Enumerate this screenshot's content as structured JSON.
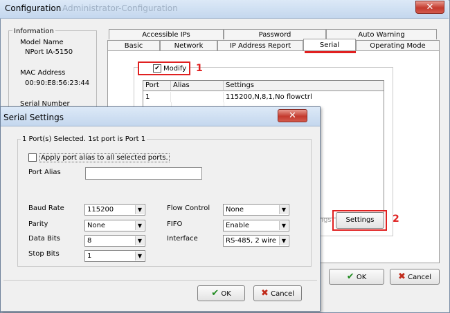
{
  "window": {
    "title": "Configuration",
    "ghost_title": "Administrator-Configuration",
    "close_glyph": "✕"
  },
  "info": {
    "legend": "Information",
    "model_name_label": "Model Name",
    "model_name_value": "NPort IA-5150",
    "mac_label": "MAC Address",
    "mac_value": "00:90:E8:56:23:44",
    "serial_number_label": "Serial Number"
  },
  "tabs": {
    "row1": [
      "Accessible IPs",
      "Password",
      "Auto Warning"
    ],
    "row2": [
      "Basic",
      "Network",
      "IP Address Report",
      "Serial",
      "Operating Mode"
    ],
    "active": "Serial"
  },
  "serial_panel": {
    "modify_checked": true,
    "modify_label": "Modify",
    "annotation_1": "1",
    "annotation_2": "2",
    "table_headers": [
      "Port",
      "Alias",
      "Settings"
    ],
    "rows": [
      {
        "port": "1",
        "alias": "",
        "settings": "115200,N,8,1,No flowctrl"
      }
    ],
    "hidden_button_fragment": "ings",
    "settings_button": "Settings",
    "ok_button": "OK",
    "cancel_button": "Cancel"
  },
  "dialog": {
    "title": "Serial Settings",
    "close_glyph": "✕",
    "group_legend": "1 Port(s) Selected. 1st port is Port 1",
    "apply_alias_label": "Apply port alias to all selected ports.",
    "apply_alias_checked": false,
    "port_alias_label": "Port Alias",
    "port_alias_value": "",
    "baud_rate_label": "Baud Rate",
    "baud_rate_value": "115200",
    "parity_label": "Parity",
    "parity_value": "None",
    "data_bits_label": "Data Bits",
    "data_bits_value": "8",
    "stop_bits_label": "Stop Bits",
    "stop_bits_value": "1",
    "flow_control_label": "Flow Control",
    "flow_control_value": "None",
    "fifo_label": "FIFO",
    "fifo_value": "Enable",
    "interface_label": "Interface",
    "interface_value": "RS-485, 2 wire",
    "ok_button": "OK",
    "cancel_button": "Cancel"
  },
  "colors": {
    "highlight": "#e02020",
    "ok_check": "#1e8a1e",
    "cancel_x": "#c02a1a"
  },
  "icons": {
    "check": "check-icon",
    "cancel": "cancel-x-icon",
    "dropdown": "chevron-down-icon"
  }
}
